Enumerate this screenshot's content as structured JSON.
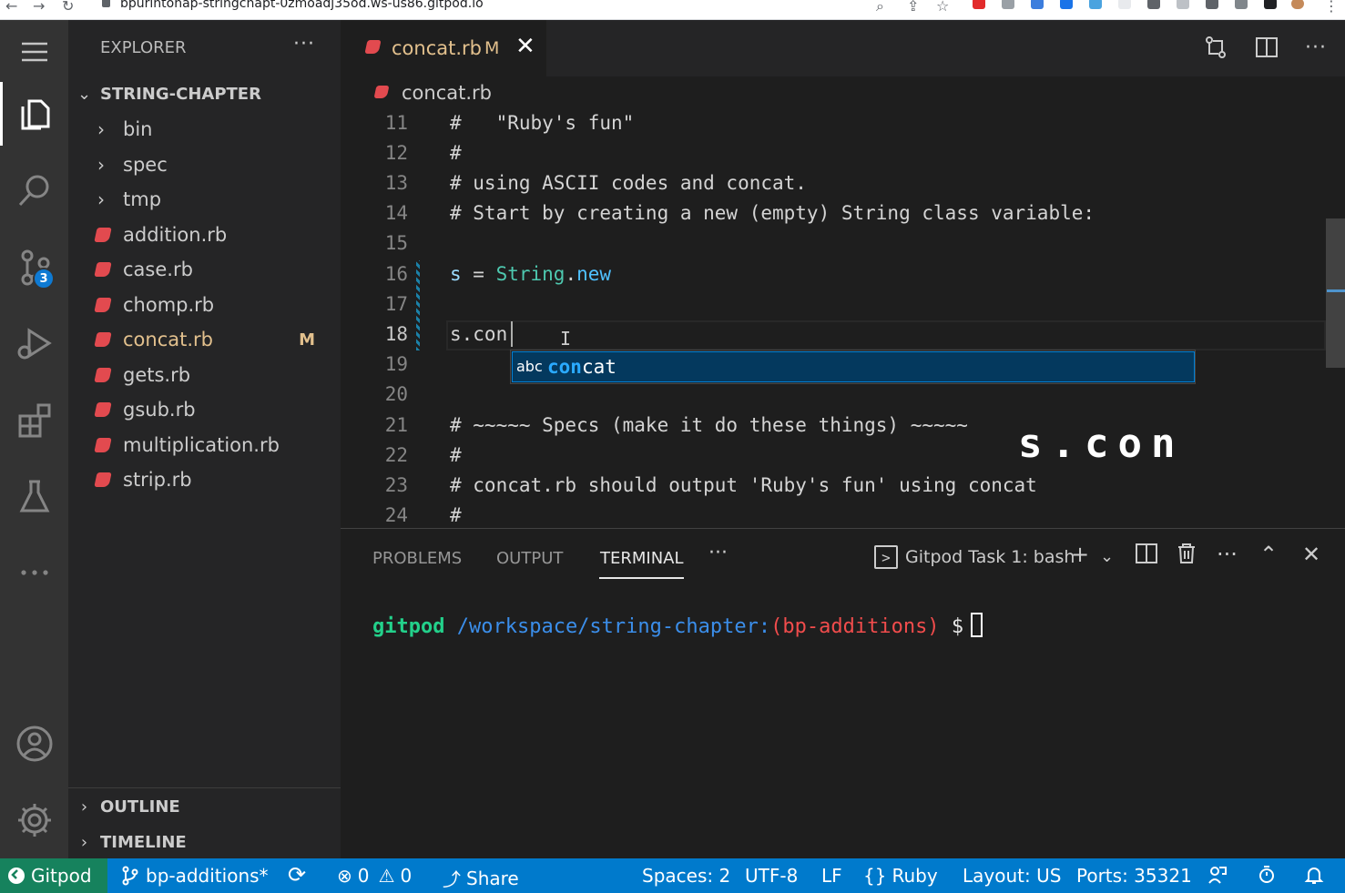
{
  "browser": {
    "url": "bpurintonap-stringchapt-0zmoadj35od.ws-us86.gitpod.io"
  },
  "activity_bar": {
    "source_control_badge": "3"
  },
  "explorer": {
    "title": "EXPLORER",
    "root_folder": "STRING-CHAPTER",
    "folders": [
      "bin",
      "spec",
      "tmp"
    ],
    "files": [
      {
        "name": "addition.rb",
        "status": ""
      },
      {
        "name": "case.rb",
        "status": ""
      },
      {
        "name": "chomp.rb",
        "status": ""
      },
      {
        "name": "concat.rb",
        "status": "M"
      },
      {
        "name": "gets.rb",
        "status": ""
      },
      {
        "name": "gsub.rb",
        "status": ""
      },
      {
        "name": "multiplication.rb",
        "status": ""
      },
      {
        "name": "strip.rb",
        "status": ""
      }
    ],
    "outline_label": "OUTLINE",
    "timeline_label": "TIMELINE"
  },
  "editor": {
    "tab_name": "concat.rb",
    "tab_status": "M",
    "breadcrumb": "concat.rb",
    "lines": [
      {
        "n": "11",
        "text": "#   \"Ruby's fun\""
      },
      {
        "n": "12",
        "text": "#"
      },
      {
        "n": "13",
        "text": "# using ASCII codes and concat."
      },
      {
        "n": "14",
        "text": "# Start by creating a new (empty) String class variable:"
      },
      {
        "n": "15",
        "text": ""
      },
      {
        "n": "16",
        "var": "s",
        "op": " = ",
        "cls": "String",
        "dot": ".",
        "fn": "new"
      },
      {
        "n": "17",
        "text": ""
      },
      {
        "n": "18",
        "text": "s.con"
      },
      {
        "n": "19",
        "text": ""
      },
      {
        "n": "20",
        "text": ""
      },
      {
        "n": "21",
        "text": "# ~~~~~ Specs (make it do these things) ~~~~~"
      },
      {
        "n": "22",
        "text": "#"
      },
      {
        "n": "23",
        "text": "# concat.rb should output 'Ruby's fun' using concat"
      },
      {
        "n": "24",
        "text": "#"
      }
    ],
    "suggestion": {
      "kind_label": "abc",
      "match": "con",
      "rest": "cat"
    },
    "keystroke_overlay": "s.con"
  },
  "panel": {
    "tabs": [
      "PROBLEMS",
      "OUTPUT",
      "TERMINAL"
    ],
    "active_tab": "TERMINAL",
    "terminal_selector": "Gitpod Task 1: bash",
    "prompt": {
      "user": "gitpod",
      "path": "/workspace/string-chapter",
      "colon": ":",
      "branch": "(bp-additions)",
      "dollar": "$"
    }
  },
  "statusbar": {
    "remote": "Gitpod",
    "branch": "bp-additions*",
    "errors": "0",
    "warnings": "0",
    "share": "Share",
    "spaces": "Spaces: 2",
    "encoding": "UTF-8",
    "eol": "LF",
    "language": "Ruby",
    "layout": "Layout: US",
    "ports": "Ports: 35321"
  },
  "colors": {
    "statusbar": "#007acc",
    "remote": "#16825d",
    "modified": "#e2c08d",
    "ruby_icon": "#e24a4f"
  }
}
